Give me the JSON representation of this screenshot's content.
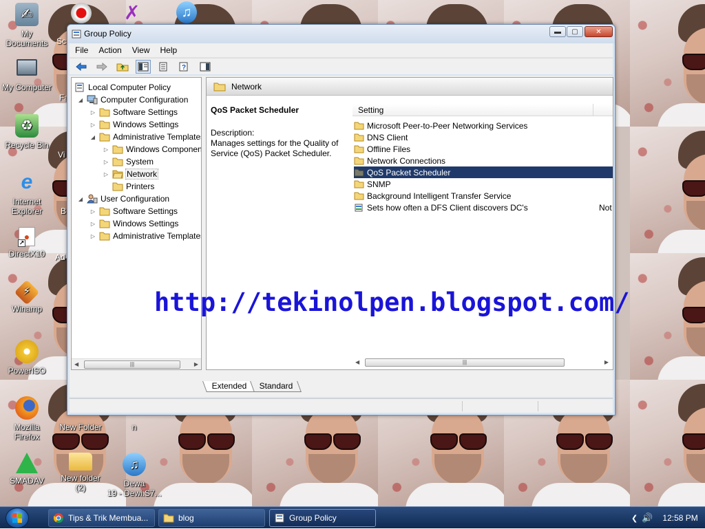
{
  "desktop": {
    "icons": [
      {
        "label": "My\nDocuments"
      },
      {
        "label": "My Computer"
      },
      {
        "label": "Recycle Bin"
      },
      {
        "label": "Internet\nExplorer"
      },
      {
        "label": "DirectX10"
      },
      {
        "label": "Winamp"
      },
      {
        "label": "PowerISO"
      },
      {
        "label": "Mozilla\nFirefox"
      },
      {
        "label": "New Folder"
      },
      {
        "label": "n"
      },
      {
        "label": "SMADAV"
      },
      {
        "label": "New folder\n(2)"
      },
      {
        "label": "Dewa\n19 - Dewi.S7..."
      }
    ],
    "partial_labels": [
      "Sc",
      "Fa",
      "Vi",
      "B",
      "Ad"
    ]
  },
  "window": {
    "title": "Group Policy",
    "menu": [
      "File",
      "Action",
      "View",
      "Help"
    ],
    "tree": [
      {
        "label": "Local Computer Policy"
      },
      {
        "label": "Computer Configuration"
      },
      {
        "label": "Software Settings"
      },
      {
        "label": "Windows Settings"
      },
      {
        "label": "Administrative Templates"
      },
      {
        "label": "Windows Components"
      },
      {
        "label": "System"
      },
      {
        "label": "Network"
      },
      {
        "label": "Printers"
      },
      {
        "label": "User Configuration"
      },
      {
        "label": "Software Settings"
      },
      {
        "label": "Windows Settings"
      },
      {
        "label": "Administrative Templates"
      }
    ],
    "right_header": "Network",
    "description": {
      "title": "QoS Packet Scheduler",
      "label": "Description:",
      "text": "Manages settings for the Quality of Service (QoS) Packet Scheduler."
    },
    "list_column": "Setting",
    "list": [
      {
        "label": "Microsoft Peer-to-Peer Networking Services",
        "state": ""
      },
      {
        "label": "DNS Client",
        "state": ""
      },
      {
        "label": "Offline Files",
        "state": ""
      },
      {
        "label": "Network Connections",
        "state": ""
      },
      {
        "label": "QoS Packet Scheduler",
        "state": ""
      },
      {
        "label": "SNMP",
        "state": ""
      },
      {
        "label": "Background Intelligent Transfer Service",
        "state": ""
      },
      {
        "label": "Sets how often a DFS Client discovers DC's",
        "state": "Not"
      }
    ],
    "tabs": [
      "Extended",
      "Standard"
    ]
  },
  "watermark": "http://tekinolpen.blogspot.com/",
  "taskbar": {
    "tasks": [
      {
        "label": "Tips & Trik Membua..."
      },
      {
        "label": "blog"
      },
      {
        "label": "Group Policy"
      }
    ],
    "clock": "12:58 PM"
  },
  "colors": {
    "selection": "#1f3a6a",
    "watermark": "#1a14d8",
    "taskbar": "#1b3664"
  }
}
